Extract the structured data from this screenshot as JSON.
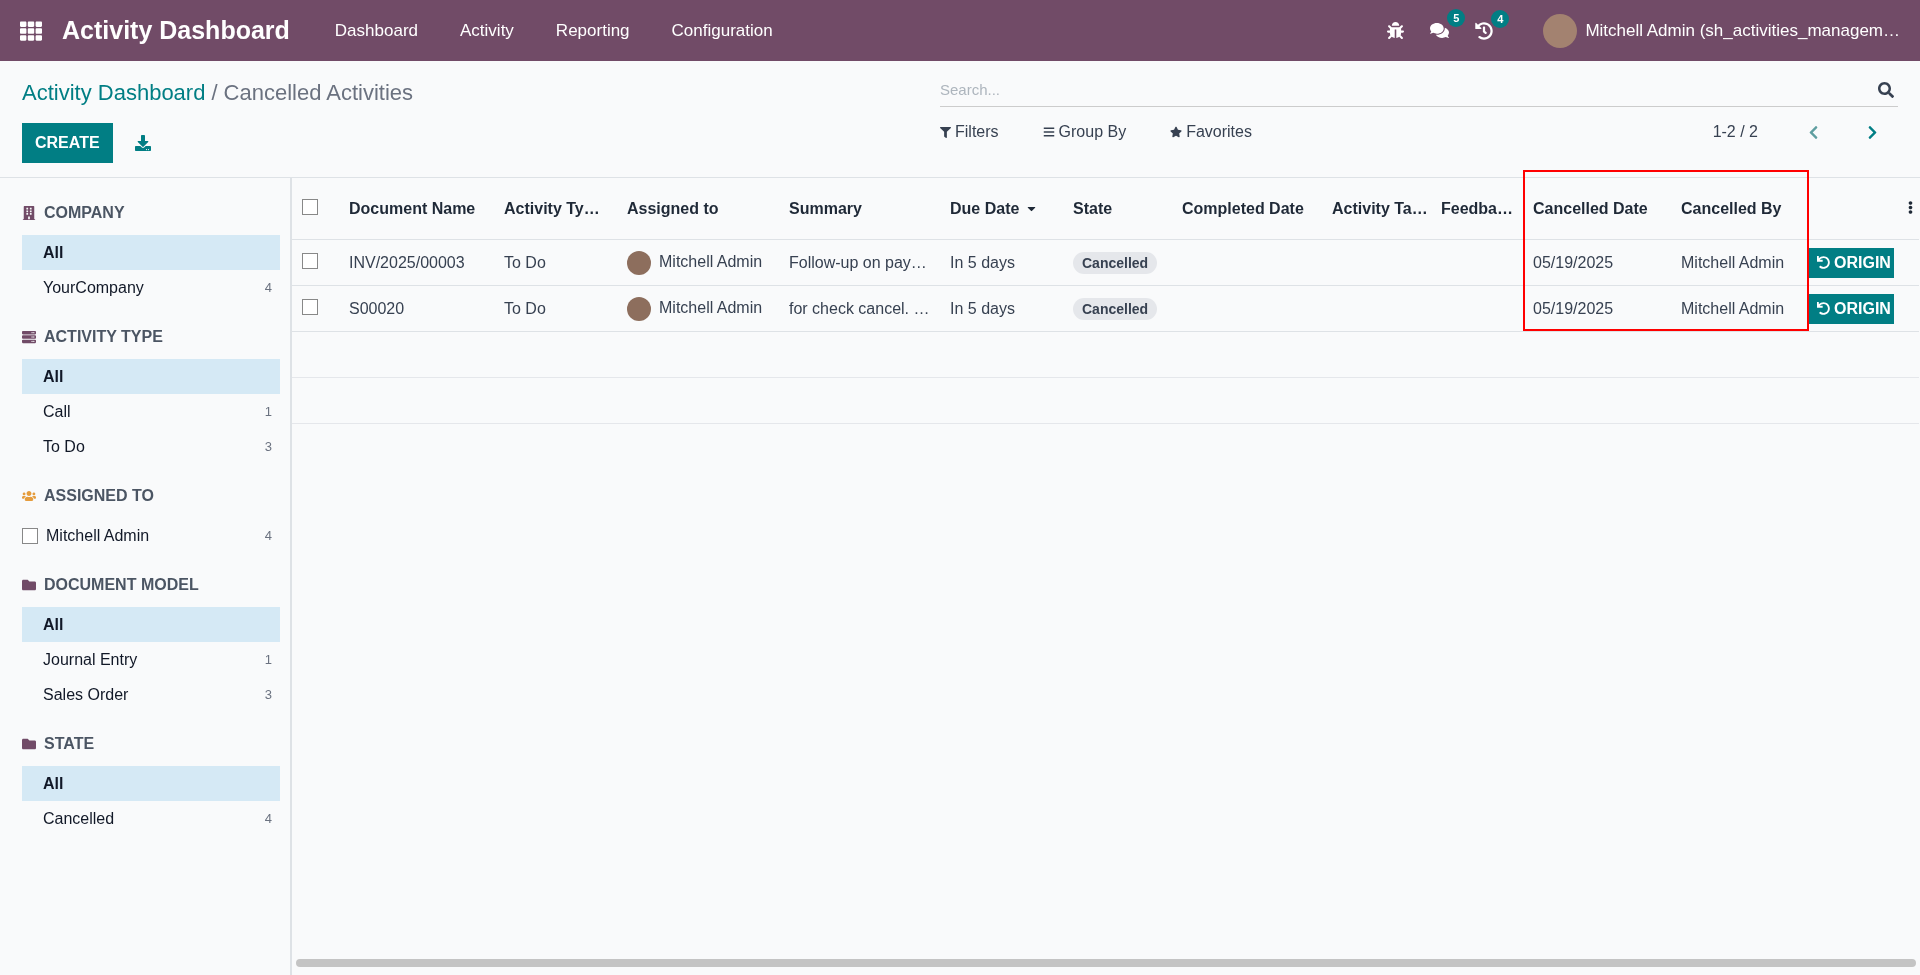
{
  "navbar": {
    "app_title": "Activity Dashboard",
    "menu": [
      "Dashboard",
      "Activity",
      "Reporting",
      "Configuration"
    ],
    "messages_badge": "5",
    "activities_badge": "4",
    "user": "Mitchell Admin (sh_activities_managem…"
  },
  "breadcrumb": {
    "parent": "Activity Dashboard",
    "separator": "/",
    "current": "Cancelled Activities"
  },
  "search": {
    "placeholder": "Search..."
  },
  "create_button": "CREATE",
  "search_options": [
    {
      "kind": "filter",
      "label": "Filters"
    },
    {
      "kind": "group",
      "label": "Group By"
    },
    {
      "kind": "favorite",
      "label": "Favorites"
    }
  ],
  "pager": "1-2 / 2",
  "sidebar": [
    {
      "title": "COMPANY",
      "kind": "select",
      "items": [
        {
          "label": "All",
          "selected": true
        },
        {
          "label": "YourCompany",
          "count": "4",
          "selected": false
        }
      ]
    },
    {
      "title": "ACTIVITY TYPE",
      "kind": "select",
      "items": [
        {
          "label": "All",
          "selected": true
        },
        {
          "label": "Call",
          "count": "1",
          "selected": false
        },
        {
          "label": "To Do",
          "count": "3",
          "selected": false
        }
      ]
    },
    {
      "title": "ASSIGNED TO",
      "kind": "checkbox",
      "items": [
        {
          "label": "Mitchell Admin",
          "count": "4",
          "checked": false
        }
      ]
    },
    {
      "title": "DOCUMENT MODEL",
      "kind": "select",
      "items": [
        {
          "label": "All",
          "selected": true
        },
        {
          "label": "Journal Entry",
          "count": "1",
          "selected": false
        },
        {
          "label": "Sales Order",
          "count": "3",
          "selected": false
        }
      ]
    },
    {
      "title": "STATE",
      "kind": "select",
      "items": [
        {
          "label": "All",
          "selected": true
        },
        {
          "label": "Cancelled",
          "count": "4",
          "selected": false
        }
      ]
    }
  ],
  "table": {
    "select_all_checked": false,
    "columns": [
      {
        "label": "Document Name",
        "sorted": false,
        "highlighted": false
      },
      {
        "label": "Activity Ty…",
        "sorted": false,
        "highlighted": false
      },
      {
        "label": "Assigned to",
        "sorted": false,
        "highlighted": false
      },
      {
        "label": "Summary",
        "sorted": false,
        "highlighted": false
      },
      {
        "label": "Due Date",
        "sorted": true,
        "highlighted": false
      },
      {
        "label": "State",
        "sorted": false,
        "highlighted": false
      },
      {
        "label": "Completed Date",
        "sorted": false,
        "highlighted": false
      },
      {
        "label": "Activity Ta…",
        "sorted": false,
        "highlighted": false
      },
      {
        "label": "Feedba…",
        "sorted": false,
        "highlighted": false
      },
      {
        "label": "Cancelled Date",
        "sorted": false,
        "highlighted": true
      },
      {
        "label": "Cancelled By",
        "sorted": false,
        "highlighted": true
      }
    ],
    "rows": [
      {
        "checked": false,
        "document_name": "INV/2025/00003",
        "activity_type": "To Do",
        "assigned_to": "Mitchell Admin",
        "summary": "Follow-up on pay…",
        "due_date": "In 5 days",
        "state": "Cancelled",
        "cancelled_date": "05/19/2025",
        "cancelled_by": "Mitchell Admin",
        "action": "ORIGIN"
      },
      {
        "checked": false,
        "document_name": "S00020",
        "activity_type": "To Do",
        "assigned_to": "Mitchell Admin",
        "summary": "for check cancel. …",
        "due_date": "In 5 days",
        "state": "Cancelled",
        "cancelled_date": "05/19/2025",
        "cancelled_by": "Mitchell Admin",
        "action": "ORIGIN"
      }
    ]
  }
}
